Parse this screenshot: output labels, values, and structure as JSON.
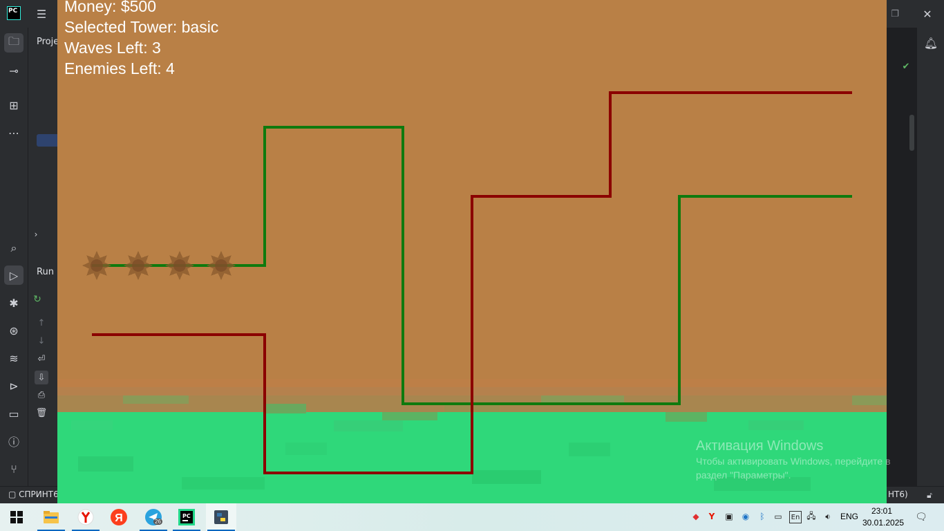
{
  "ide": {
    "logo_text": "PC",
    "project_tab_label": "Proje",
    "run_tab_label": "Run",
    "status_left": "СПРИНТ6",
    "status_right": "HT6)"
  },
  "game": {
    "hud": {
      "money": "Money: $500",
      "selected_tower": "Selected Tower: basic",
      "waves_left": "Waves Left: 3",
      "enemies_left": "Enemies Left: 4"
    },
    "colors": {
      "dirt": "#b98046",
      "grass": "#2fd87a",
      "green_path": "#0e7a0e",
      "red_path": "#8b0000",
      "enemy": "#8a5a2e"
    },
    "enemies_count": 4
  },
  "watermark": {
    "title": "Активация Windows",
    "line1": "Чтобы активировать Windows, перейдите в",
    "line2": "раздел \"Параметры\"."
  },
  "taskbar": {
    "apps": [
      "explorer-icon",
      "yandex-browser-icon",
      "yandex-icon",
      "telegram-icon",
      "pycharm-icon",
      "python-icon"
    ],
    "telegram_badge": "26",
    "language": "ENG",
    "time": "23:01",
    "date": "30.01.2025"
  }
}
